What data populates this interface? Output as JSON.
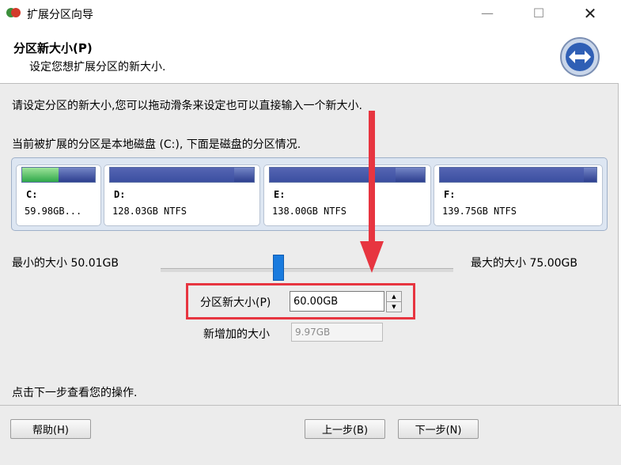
{
  "window": {
    "title": "扩展分区向导"
  },
  "header": {
    "title": "分区新大小(P)",
    "subtitle": "设定您想扩展分区的新大小."
  },
  "body": {
    "instruction": "请设定分区的新大小,您可以拖动滑条来设定也可以直接输入一个新大小.",
    "disk_intro": "当前被扩展的分区是本地磁盘 (C:), 下面是磁盘的分区情况.",
    "partitions": [
      {
        "letter": "C:",
        "info": "59.98GB...",
        "used_fraction": 0.5
      },
      {
        "letter": "D:",
        "info": "128.03GB NTFS",
        "used_fraction": 0.86
      },
      {
        "letter": "E:",
        "info": "138.00GB NTFS",
        "used_fraction": 0.81
      },
      {
        "letter": "F:",
        "info": "139.75GB NTFS",
        "used_fraction": 0.92
      }
    ],
    "min_label": "最小的大小 50.01GB",
    "max_label": "最大的大小 75.00GB",
    "newsize_label": "分区新大小(P)",
    "newsize_value": "60.00GB",
    "added_label": "新增加的大小",
    "added_value": "9.97GB",
    "footer_hint": "点击下一步查看您的操作."
  },
  "buttons": {
    "help": "帮助(H)",
    "back": "上一步(B)",
    "next": "下一步(N)"
  },
  "colors": {
    "highlight": "#e73540",
    "slider": "#1a7bde",
    "partition_used": "#3b4fa0",
    "partition_c_used": "#2fa84a"
  }
}
